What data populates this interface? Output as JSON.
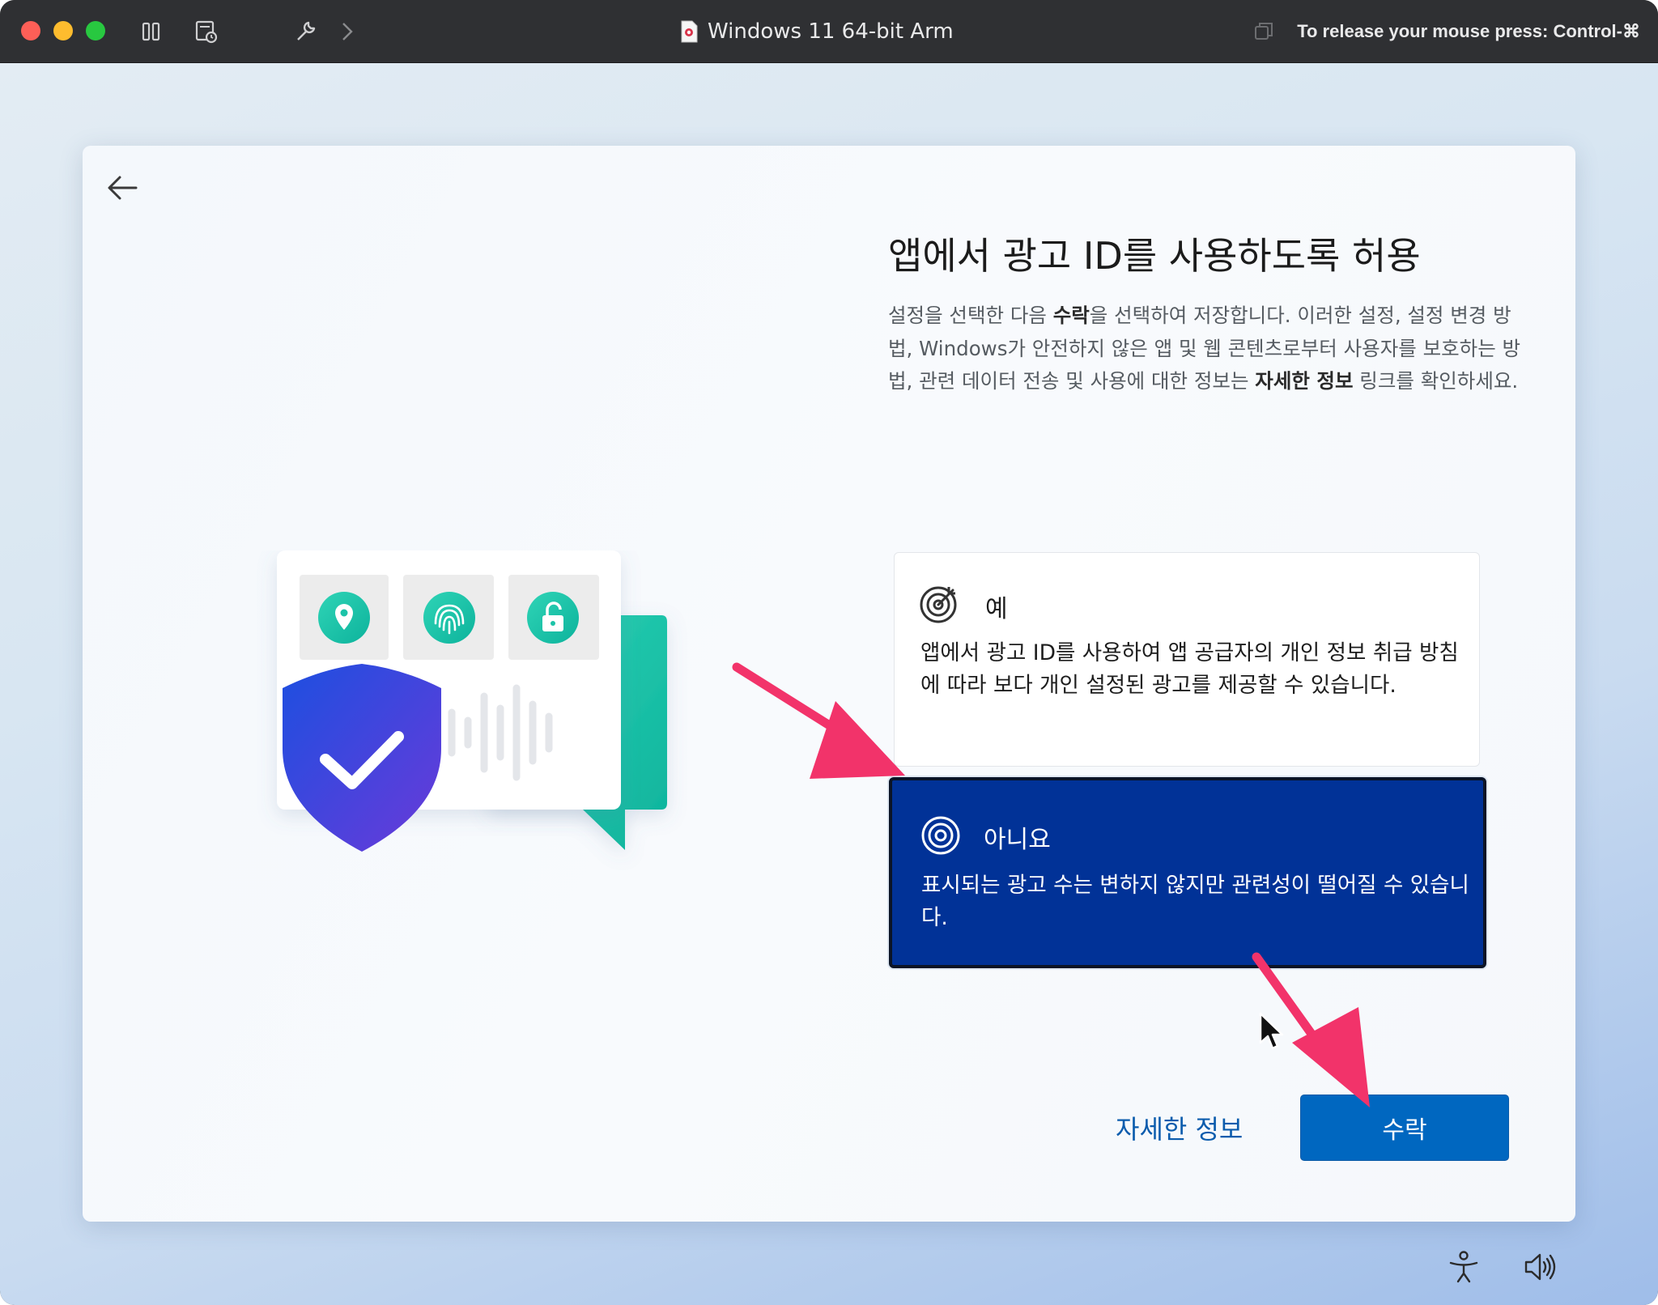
{
  "window": {
    "title": "Windows 11 64-bit Arm",
    "release_hint": "To release your mouse press: Control-⌘"
  },
  "toolbar": {
    "icons": [
      "pause-icon",
      "snapshot-icon",
      "settings-wrench-icon",
      "forward-chevron-icon",
      "window-restore-icon"
    ]
  },
  "oobe": {
    "heading": "앱에서 광고 ID를 사용하도록 허용",
    "description": {
      "part1": "설정을 선택한 다음 ",
      "bold1": "수락",
      "part2": "을 선택하여 저장합니다. 이러한 설정, 설정 변경 방법, Windows가 안전하지 않은 앱 및 웹 콘텐츠로부터 사용자를 보호하는 방법, 관련 데이터 전송 및 사용에 대한 정보는 ",
      "bold2": "자세한 정보",
      "part3": " 링크를 확인하세요."
    },
    "options": [
      {
        "title": "예",
        "description": "앱에서 광고 ID를 사용하여 앱 공급자의 개인 정보 취급 방침에 따라 보다 개인 설정된 광고를 제공할 수 있습니다.",
        "selected": false,
        "icon": "target-icon"
      },
      {
        "title": "아니요",
        "description": "표시되는 광고 수는 변하지 않지만 관련성이 떨어질 수 있습니다.",
        "selected": true,
        "icon": "target-off-icon"
      }
    ],
    "learn_more": "자세한 정보",
    "accept": "수락"
  },
  "colors": {
    "selected_option": "#013297",
    "accept_button": "#0067c0",
    "link": "#0b5cad",
    "annotation_arrow": "#f2336a"
  },
  "system_tray": {
    "icons": [
      "accessibility-icon",
      "volume-icon"
    ]
  }
}
